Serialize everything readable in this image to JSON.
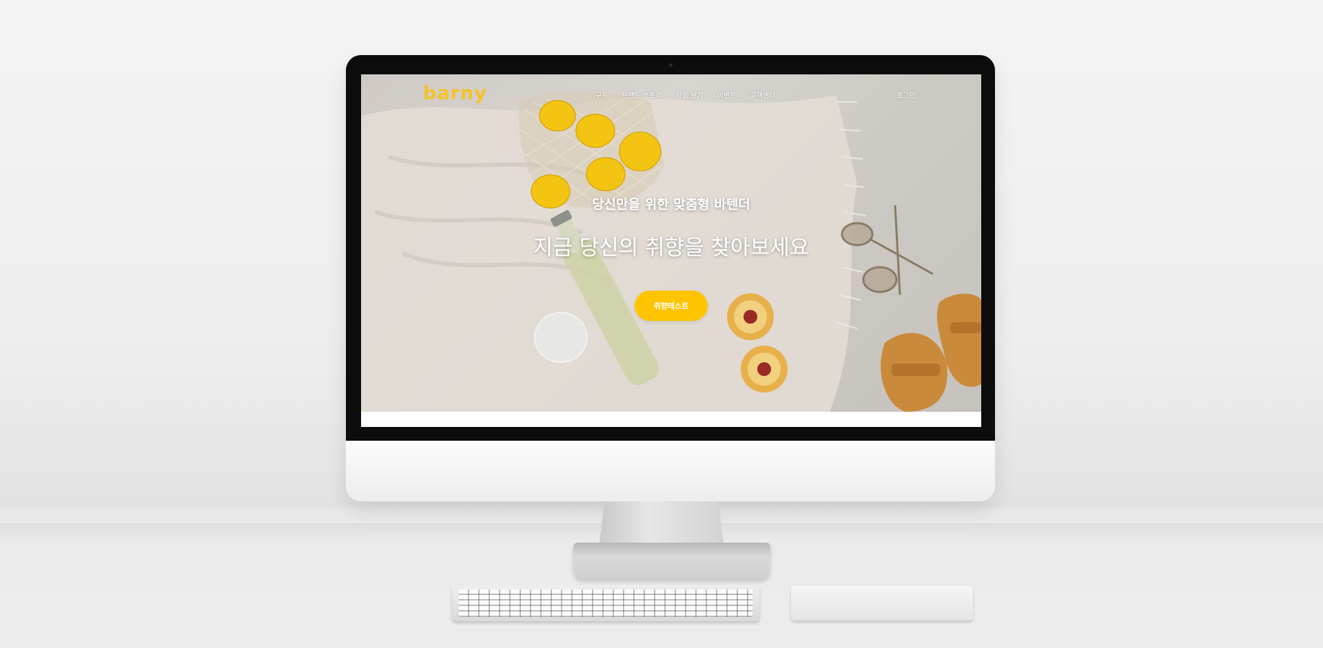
{
  "site": {
    "logo": "barny",
    "nav": [
      "구독",
      "브랜드 스토리",
      "상품 보기",
      "이벤트",
      "고객센터"
    ],
    "login": "로그인"
  },
  "hero": {
    "subtitle": "당신만을 위한 맞춤형 바텐더",
    "title": "지금 당신의 취향을 찾아보세요",
    "cta_label": "취향테스트"
  },
  "colors": {
    "brand": "#f5c325",
    "cta": "#ffc400"
  }
}
